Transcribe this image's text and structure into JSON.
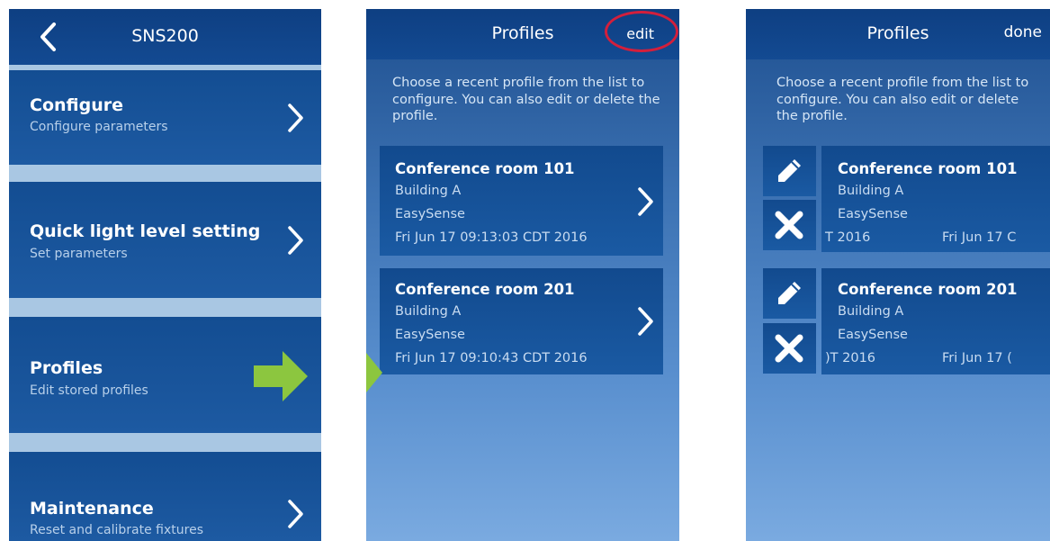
{
  "screen1": {
    "title": "SNS200",
    "menu": [
      {
        "label": "Configure",
        "sub": "Configure parameters"
      },
      {
        "label": "Quick light level setting",
        "sub": "Set parameters"
      },
      {
        "label": "Profiles",
        "sub": "Edit stored profiles"
      },
      {
        "label": "Maintenance",
        "sub": "Reset and calibrate fixtures"
      }
    ]
  },
  "screen2": {
    "title": "Profiles",
    "edit_label": "edit",
    "intro": "Choose a recent profile from the list to configure. You can also edit or delete the profile.",
    "profiles": [
      {
        "name": "Conference room 101",
        "building": "Building A",
        "system": "EasySense",
        "date": "Fri Jun 17 09:13:03 CDT 2016"
      },
      {
        "name": "Conference room 201",
        "building": "Building A",
        "system": "EasySense",
        "date": "Fri Jun 17 09:10:43 CDT 2016"
      }
    ]
  },
  "screen3": {
    "title": "Profiles",
    "done_label": "done",
    "intro": "Choose a recent profile from the list to configure. You can also edit or delete the profile.",
    "profiles": [
      {
        "name": "Conference room 101",
        "building": "Building A",
        "system": "EasySense",
        "date_left": "T 2016",
        "date_right": "Fri Jun 17 C"
      },
      {
        "name": "Conference room 201",
        "building": "Building A",
        "system": "EasySense",
        "date_left": ")T 2016",
        "date_right": "Fri Jun 17 ("
      }
    ]
  },
  "colors": {
    "accent_arrow": "#8cc63f",
    "highlight_ring": "#d31f3c",
    "header": "#0e3f82"
  },
  "icons": [
    "back-chevron-icon",
    "chevron-right-icon",
    "pencil-icon",
    "x-icon",
    "arrow-right-icon"
  ]
}
